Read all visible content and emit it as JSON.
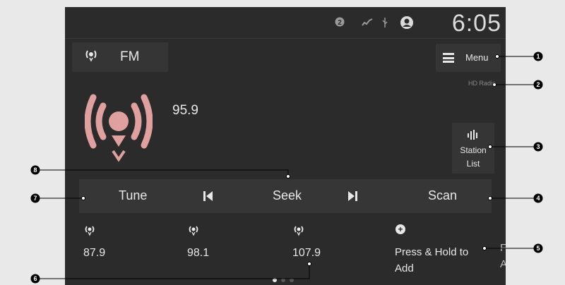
{
  "status_bar": {
    "time": "6:05",
    "icons": [
      "notification-badge-icon",
      "signal-icon",
      "usb-icon",
      "user-profile-icon"
    ],
    "badge_count": "2"
  },
  "source": {
    "label": "FM",
    "icon": "radio-broadcast-icon"
  },
  "menu": {
    "label": "Menu",
    "icon": "hamburger-icon"
  },
  "hd_radio": {
    "label": "HD Radio"
  },
  "now_playing": {
    "frequency": "95.9"
  },
  "station_list": {
    "line1": "Station",
    "line2": "List"
  },
  "controls": {
    "tune": "Tune",
    "seek": "Seek",
    "scan": "Scan"
  },
  "presets": [
    {
      "label": "87.9"
    },
    {
      "label": "98.1"
    },
    {
      "label": "107.9"
    }
  ],
  "add_preset": {
    "line1": "Press & Hold to",
    "line2": "Add"
  },
  "partial_tile": {
    "line1": "F",
    "line2": "A"
  },
  "page_indicator": {
    "pages": 3,
    "active": 1
  },
  "callouts": [
    "1",
    "2",
    "3",
    "4",
    "5",
    "6",
    "7",
    "8"
  ],
  "colors": {
    "screen": "#2b2b2b",
    "tile": "#353535",
    "text": "#e8e8e8",
    "icon_red": "#e0a0a0"
  }
}
